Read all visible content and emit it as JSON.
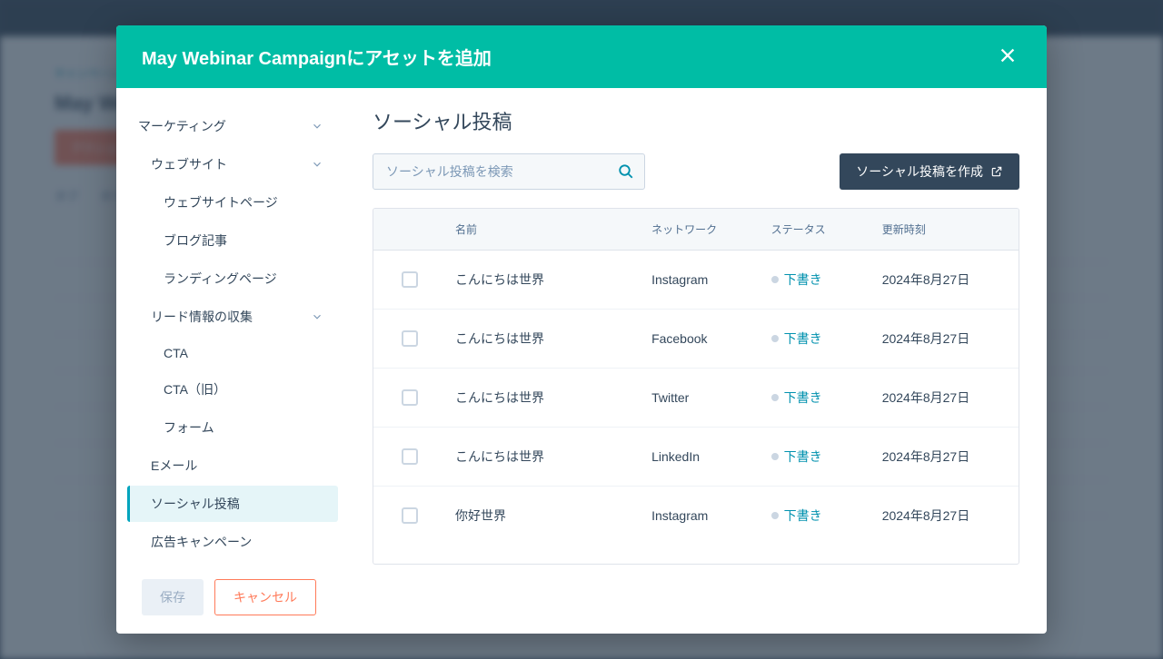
{
  "modal": {
    "title": "May Webinar Campaignにアセットを追加"
  },
  "sidebar": {
    "items": [
      {
        "label": "マーケティング",
        "level": 0,
        "expandable": true
      },
      {
        "label": "ウェブサイト",
        "level": 1,
        "expandable": true
      },
      {
        "label": "ウェブサイトページ",
        "level": 2,
        "expandable": false
      },
      {
        "label": "ブログ記事",
        "level": 2,
        "expandable": false
      },
      {
        "label": "ランディングページ",
        "level": 2,
        "expandable": false
      },
      {
        "label": "リード情報の収集",
        "level": 1,
        "expandable": true
      },
      {
        "label": "CTA",
        "level": 2,
        "expandable": false
      },
      {
        "label": "CTA（旧）",
        "level": 2,
        "expandable": false
      },
      {
        "label": "フォーム",
        "level": 2,
        "expandable": false
      },
      {
        "label": "Eメール",
        "level": 1,
        "expandable": false
      },
      {
        "label": "ソーシャル投稿",
        "level": 1,
        "expandable": false,
        "active": true
      },
      {
        "label": "広告キャンペーン",
        "level": 1,
        "expandable": false
      }
    ]
  },
  "content": {
    "heading": "ソーシャル投稿",
    "search_placeholder": "ソーシャル投稿を検索",
    "create_button": "ソーシャル投稿を作成",
    "columns": {
      "name": "名前",
      "network": "ネットワーク",
      "status": "ステータス",
      "updated": "更新時刻"
    },
    "rows": [
      {
        "name": "こんにちは世界",
        "network": "Instagram",
        "status": "下書き",
        "updated": "2024年8月27日"
      },
      {
        "name": "こんにちは世界",
        "network": "Facebook",
        "status": "下書き",
        "updated": "2024年8月27日"
      },
      {
        "name": "こんにちは世界",
        "network": "Twitter",
        "status": "下書き",
        "updated": "2024年8月27日"
      },
      {
        "name": "こんにちは世界",
        "network": "LinkedIn",
        "status": "下書き",
        "updated": "2024年8月27日"
      },
      {
        "name": "你好世界",
        "network": "Instagram",
        "status": "下書き",
        "updated": "2024年8月27日"
      }
    ]
  },
  "footer": {
    "save": "保存",
    "cancel": "キャンセル"
  },
  "background": {
    "breadcrumb": "キャンペーン",
    "title": "May Webinar Campaign",
    "action": "アクション"
  }
}
